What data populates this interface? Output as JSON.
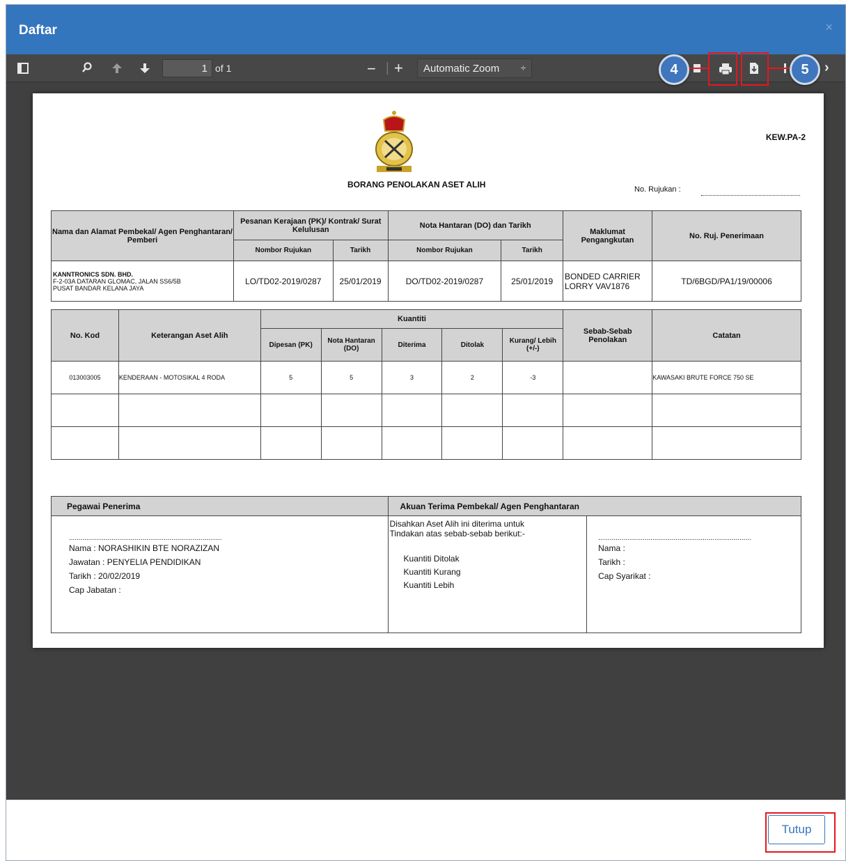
{
  "modal": {
    "title": "Daftar",
    "close": "×"
  },
  "toolbar": {
    "page_current": "1",
    "page_of": "of 1",
    "zoom": "Automatic Zoom",
    "badge_left": "4",
    "badge_right": "5"
  },
  "form": {
    "code": "KEW.PA-2",
    "title": "BORANG PENOLAKAN ASET ALIH",
    "ref_label": "No. Rujukan  :",
    "t1": {
      "h_supplier": "Nama dan Alamat Pembekal/ Agen Penghantaran/ Pemberi",
      "h_pk": "Pesanan Kerajaan (PK)/ Kontrak/ Surat Kelulusan",
      "h_do": "Nota Hantaran (DO) dan Tarikh",
      "h_transport": "Maklumat Pengangkutan",
      "h_receipt": "No. Ruj. Penerimaan",
      "h_nombor1": "Nombor Rujukan",
      "h_tarikh1": "Tarikh",
      "h_nombor2": "Nombor Rujukan",
      "h_tarikh2": "Tarikh",
      "supplier_name": "KANNTRONICS SDN. BHD.",
      "supplier_addr1": "F-2-03A DATARAN GLOMAC, JALAN SS6/5B",
      "supplier_addr2": "PUSAT BANDAR KELANA JAYA",
      "pk_no": "LO/TD02-2019/0287",
      "pk_date": "25/01/2019",
      "do_no": "DO/TD02-2019/0287",
      "do_date": "25/01/2019",
      "transport1": "BONDED CARRIER",
      "transport2": "LORRY  VAV1876",
      "receipt": "TD/6BGD/PA1/19/00006"
    },
    "t2": {
      "h_kod": "No. Kod",
      "h_keterangan": "Keterangan Aset Alih",
      "h_kuantiti": "Kuantiti",
      "h_dipesan": "Dipesan (PK)",
      "h_nota": "Nota Hantaran (DO)",
      "h_diterima": "Diterima",
      "h_ditolak": "Ditolak",
      "h_kurang": "Kurang/ Lebih (+/-)",
      "h_sebab": "Sebab-Sebab Penolakan",
      "h_catatan": "Catatan",
      "row": {
        "kod": "013003005",
        "keterangan": "KENDERAAN - MOTOSIKAL 4 RODA",
        "dipesan": "5",
        "nota": "5",
        "diterima": "3",
        "ditolak": "2",
        "kurang": "-3",
        "sebab": "",
        "catatan": "KAWASAKI BRUTE FORCE 750 SE"
      }
    },
    "t3": {
      "h_pegawai": "Pegawai Penerima",
      "h_akuan": "Akuan Terima Pembekal/ Agen Penghantaran",
      "dots": "...............................................................................",
      "nama": "Nama    : NORASHIKIN BTE NORAZIZAN",
      "jawatan": "Jawatan : PENYELIA PENDIDIKAN",
      "tarikh": "Tarikh    : 20/02/2019",
      "cap": "Cap Jabatan    :",
      "akuan_line1": "Disahkan Aset Alih ini diterima untuk",
      "akuan_line2": "Tindakan atas sebab-sebab berikut:-",
      "q1": "Kuantiti Ditolak",
      "q2": "Kuantiti Kurang",
      "q3": "Kuantiti Lebih",
      "r_dots": "...............................................................................",
      "r_nama": "Nama     :",
      "r_tarikh": "Tarikh     :",
      "r_cap": "Cap Syarikat     :"
    }
  },
  "footer": {
    "close_button": "Tutup"
  },
  "colors": {
    "header": "#3476bd",
    "highlight": "#e5171f",
    "badge": "#3f76bd"
  }
}
